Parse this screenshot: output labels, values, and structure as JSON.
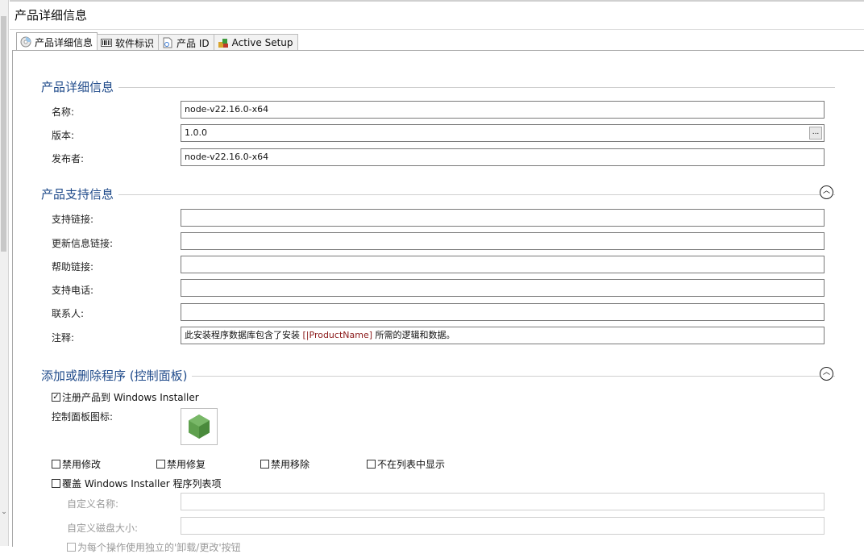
{
  "window": {
    "title": "产品详细信息"
  },
  "tabs": [
    {
      "label": "产品详细信息",
      "icon": "cd-disc-icon"
    },
    {
      "label": "软件标识",
      "icon": "barcode-icon"
    },
    {
      "label": "产品 ID",
      "icon": "document-id-icon"
    },
    {
      "label": "Active Setup",
      "icon": "colored-blocks-icon"
    }
  ],
  "product_details": {
    "header": "产品详细信息",
    "name_label": "名称:",
    "name_value": "node-v22.16.0-x64",
    "version_label": "版本:",
    "version_value": "1.0.0",
    "version_button": "...",
    "publisher_label": "发布者:",
    "publisher_value": "node-v22.16.0-x64"
  },
  "support_info": {
    "header": "产品支持信息",
    "support_link_label": "支持链接:",
    "update_link_label": "更新信息链接:",
    "help_link_label": "帮助链接:",
    "phone_label": "支持电话:",
    "contact_label": "联系人:",
    "comments_label": "注释:",
    "comments_prefix": "此安装程序数据库包含了安装 ",
    "comments_placeholder": "[|ProductName]",
    "comments_suffix": " 所需的逻辑和数据。"
  },
  "add_remove": {
    "header": "添加或删除程序 (控制面板)",
    "register_label": "注册产品到 Windows Installer",
    "register_checked": true,
    "control_panel_icon_label": "控制面板图标:",
    "control_panel_icon": "nodejs-hexagon-icon",
    "disable_modify": "禁用修改",
    "disable_repair": "禁用修复",
    "disable_remove": "禁用移除",
    "hide_in_list": "不在列表中显示",
    "override_label": "覆盖 Windows Installer 程序列表项",
    "custom_name_label": "自定义名称:",
    "custom_size_label": "自定义磁盘大小:",
    "separate_buttons_label": "为每个操作使用独立的'卸载/更改'按钮"
  },
  "colors": {
    "section_header": "#1f4a8a",
    "placeholder_text": "#8b1a1a",
    "icon_green": "#5fa04e"
  }
}
